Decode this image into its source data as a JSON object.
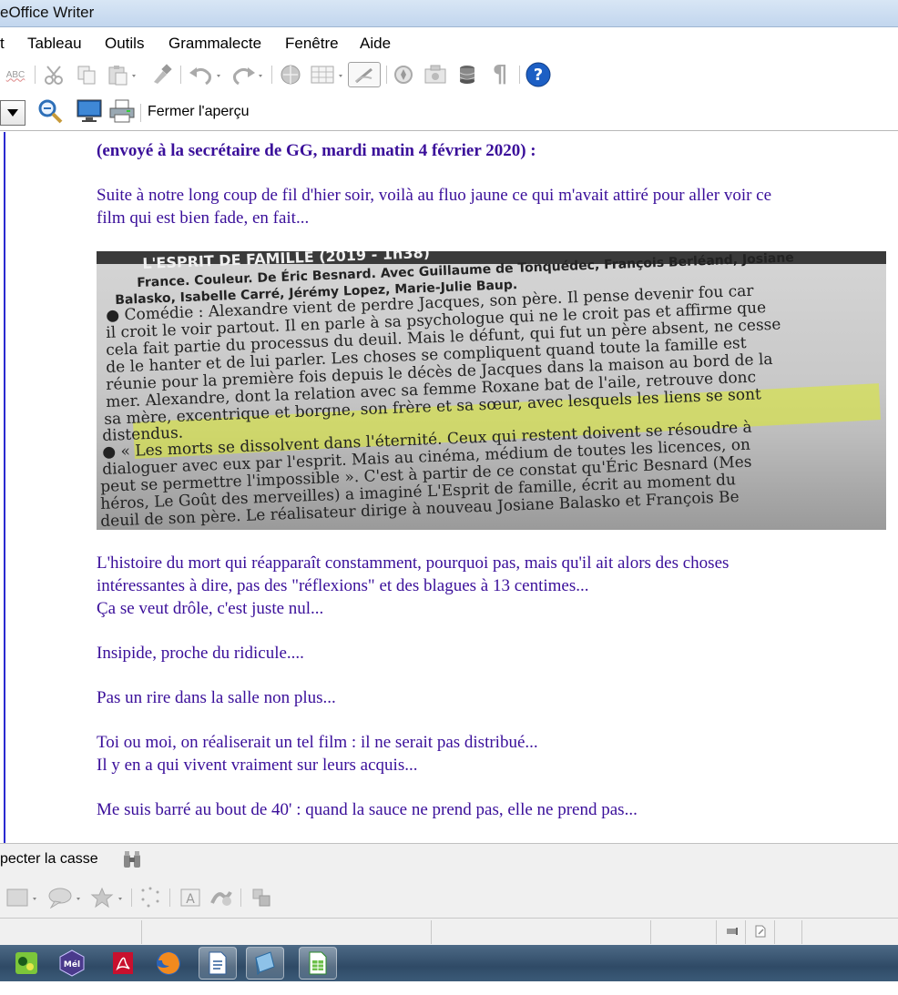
{
  "window": {
    "title": "eOffice Writer"
  },
  "menu": [
    {
      "label": "t",
      "key": "edit"
    },
    {
      "label": "Tableau",
      "key": "table"
    },
    {
      "label": "Outils",
      "key": "tools"
    },
    {
      "label": "Grammalecte",
      "key": "grammalecte"
    },
    {
      "label": "Fenêtre",
      "key": "window"
    },
    {
      "label": "Aide",
      "key": "help"
    }
  ],
  "standard_toolbar": {
    "icons": [
      "spellcheck-icon",
      "cut-icon",
      "copy-icon",
      "paste-icon",
      "clone-formatting-icon",
      "undo-icon",
      "redo-icon",
      "hyperlink-icon",
      "table-icon",
      "show-draw-functions-icon",
      "navigator-icon",
      "gallery-icon",
      "data-sources-icon",
      "formatting-marks-icon",
      "help-icon"
    ],
    "spellcheck_label": "ABC"
  },
  "preview_toolbar": {
    "close_preview_label": "Fermer l'aperçu"
  },
  "document": {
    "heading": "(envoyé à la secrétaire de GG, mardi matin 4 février 2020) :",
    "intro_line1": "Suite à notre long coup de fil d'hier soir, voilà au fluo jaune ce qui m'avait attiré pour aller voir ce",
    "intro_line2": "film qui est bien fade,  en fait...",
    "photo_lines": [
      "L'ESPRIT DE FAMILLE (2019 - 1h38)",
      "France. Couleur. De Éric Besnard. Avec Guillaume de Tonquédec, François Berléand, Josiane",
      "Balasko, Isabelle Carré, Jérémy Lopez, Marie-Julie Baup.",
      "● Comédie : Alexandre vient de perdre Jacques, son père. Il pense devenir fou car",
      "il croit le voir partout. Il en parle à sa psychologue qui ne le croit pas et affirme que",
      "cela fait partie du processus du deuil. Mais le défunt, qui fut un père absent, ne cesse",
      "de le hanter et de lui parler. Les choses se compliquent quand toute la famille est",
      "réunie pour la première fois depuis le décès de Jacques dans la maison au bord de la",
      "mer. Alexandre, dont la relation avec sa femme Roxane bat de l'aile, retrouve donc",
      "sa mère, excentrique et borgne, son frère et sa sœur, avec lesquels les liens se sont",
      "distendus.",
      "● « Les morts se dissolvent dans l'éternité. Ceux qui restent doivent se résoudre à",
      "dialoguer avec eux par l'esprit. Mais au cinéma, médium de toutes les licences, on",
      "peut se permettre l'impossible ». C'est à partir de ce constat qu'Éric Besnard (Mes",
      "héros, Le Goût des merveilles) a imaginé L'Esprit de famille, écrit au moment du",
      "deuil de son père. Le réalisateur dirige à nouveau Josiane Balasko et François Be"
    ],
    "para1_line1": "L'histoire du mort qui réapparaît constamment, pourquoi pas, mais qu'il ait alors des choses",
    "para1_line2": "intéressantes à dire, pas des \"réflexions\" et des blagues à 13 centimes...",
    "para1_line3": "Ça se veut drôle, c'est juste nul...",
    "para2": "Insipide, proche du ridicule....",
    "para3": "Pas un rire dans la salle non plus...",
    "para4_line1": "Toi ou moi, on réaliserait un tel film : il ne serait pas distribué...",
    "para4_line2": "Il y en a qui vivent vraiment sur leurs acquis...",
    "para5": "Me suis barré au bout de 40' : quand la sauce ne prend pas, elle ne prend pas..."
  },
  "find_bar": {
    "match_case_label": "pecter la casse"
  },
  "taskbar": {
    "apps": [
      "game-app-icon",
      "mel-app-icon",
      "acrobat-icon",
      "firefox-icon",
      "writer-icon",
      "notes-icon",
      "calc-icon"
    ],
    "mel_label": "Mél"
  },
  "colors": {
    "doc_text": "#3a0f9a",
    "highlight": "#dcea28",
    "page_border": "#2a2ad0"
  }
}
